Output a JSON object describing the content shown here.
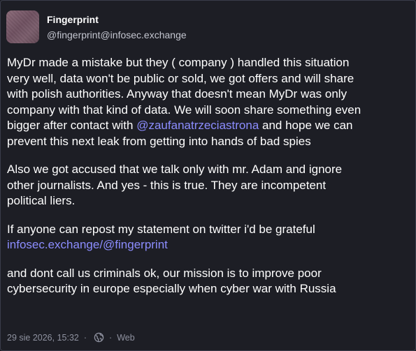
{
  "post": {
    "author": {
      "display_name": "Fingerprint",
      "handle": "@fingerprint@infosec.exchange"
    },
    "paragraphs": [
      {
        "lines": [
          "MyDr made a mistake but they ( company ) handled this situation",
          "very well, data won't be public or sold, we got offers and will share",
          "with polish authorities. Anyway that doesn't mean MyDr was only",
          "company with that kind of data. We will soon share something even"
        ],
        "mention_line": {
          "before": "bigger after contact with ",
          "mention": "@zaufanatrzeciastrona",
          "after": " and hope we can"
        },
        "last_line": "prevent this next leak from getting into hands of bad spies"
      },
      {
        "lines": [
          "Also we got accused that we talk only with mr. Adam and ignore",
          "other journalists. And yes - this is true. They are incompetent",
          "political liers."
        ]
      },
      {
        "lines": [
          "If anyone can repost my statement on twitter i'd be grateful"
        ],
        "link": "infosec.exchange/@fingerprint"
      },
      {
        "lines": [
          "and dont call us criminals ok, our mission is to improve poor",
          "cybersecurity in europe especially when cyber war with Russia"
        ]
      }
    ],
    "meta": {
      "timestamp": "29 sie 2026, 15:32",
      "separator": "·",
      "visibility_icon": "globe-icon",
      "application": "Web"
    }
  },
  "colors": {
    "background": "#1d1e25",
    "text": "#ffffff",
    "muted": "#8f92a0",
    "link": "#8c8dff"
  }
}
